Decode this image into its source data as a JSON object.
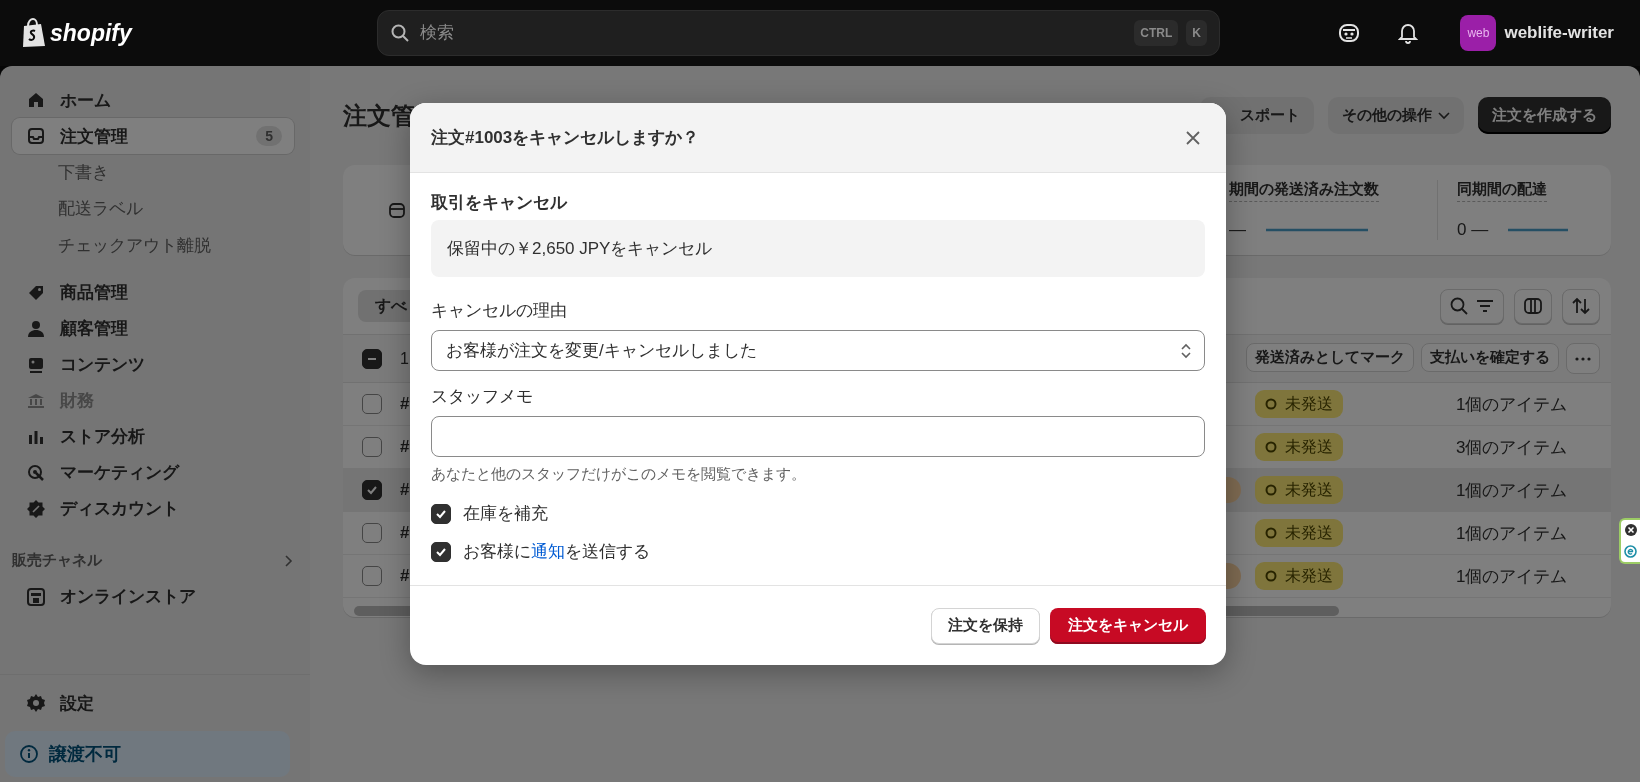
{
  "topbar": {
    "logo": "shopify",
    "search": {
      "placeholder": "検索",
      "keys": [
        "CTRL",
        "K"
      ]
    },
    "avatar": "web",
    "store_name": "weblife-writer"
  },
  "sidebar": {
    "items": [
      {
        "label": "ホーム",
        "selected": false,
        "disabled": false
      },
      {
        "label": "注文管理",
        "selected": true,
        "disabled": false,
        "badge": "5",
        "children": [
          {
            "label": "下書き"
          },
          {
            "label": "配送ラベル"
          },
          {
            "label": "チェックアウト離脱"
          }
        ]
      },
      {
        "label": "商品管理",
        "selected": false,
        "disabled": false
      },
      {
        "label": "顧客管理",
        "selected": false,
        "disabled": false
      },
      {
        "label": "コンテンツ",
        "selected": false,
        "disabled": false
      },
      {
        "label": "財務",
        "selected": false,
        "disabled": true
      },
      {
        "label": "ストア分析",
        "selected": false,
        "disabled": false
      },
      {
        "label": "マーケティング",
        "selected": false,
        "disabled": false
      },
      {
        "label": "ディスカウント",
        "selected": false,
        "disabled": false
      }
    ],
    "channels_title": "販売チャネル",
    "channels": [
      {
        "label": "オンラインストア",
        "selected": false,
        "disabled": false
      }
    ],
    "settings": "設定",
    "notice": "譲渡不可"
  },
  "main": {
    "title": "注文管",
    "header_buttons": [
      {
        "label": "スポート",
        "kind": "plain"
      },
      {
        "label": "その他の操作",
        "kind": "menu"
      },
      {
        "label": "注文を作成する",
        "kind": "primary"
      }
    ],
    "stats": [
      {
        "label": "期間の発送済み注文数",
        "value": "—"
      },
      {
        "label": "同期間の配達",
        "value": "0 —"
      }
    ],
    "table": {
      "tab": "すべ",
      "indeterminate": true,
      "selection_count": "1",
      "bulk_actions": [
        "発送済みとしてマーク",
        "支払いを確定する"
      ],
      "rows": [
        {
          "order": "#",
          "selected": false,
          "badge_2": false,
          "fulfillment": "未発送",
          "items": "1個のアイテム"
        },
        {
          "order": "#",
          "selected": false,
          "badge_2": false,
          "fulfillment": "未発送",
          "items": "3個のアイテム"
        },
        {
          "order": "#",
          "selected": true,
          "badge_2": true,
          "fulfillment": "未発送",
          "items": "1個のアイテム"
        },
        {
          "order": "#",
          "selected": false,
          "badge_2": false,
          "fulfillment": "未発送",
          "items": "1個のアイテム"
        },
        {
          "order": "#",
          "selected": false,
          "badge_2": true,
          "fulfillment": "未発送",
          "items": "1個のアイテム"
        }
      ]
    }
  },
  "modal": {
    "title": "注文#1003をキャンセルしますか？",
    "section_title": "取引をキャンセル",
    "transaction": "保留中の￥2,650 JPYをキャンセル",
    "reason_label": "キャンセルの理由",
    "reason_value": "お客様が注文を変更/キャンセルしました",
    "memo_label": "スタッフメモ",
    "memo_help": "あなたと他のスタッフだけがこのメモを閲覧できます。",
    "options": [
      {
        "label": "在庫を補充",
        "checked": true
      },
      {
        "label": "お客様に",
        "link": "通知",
        "label_after": "を送信する",
        "checked": true
      }
    ],
    "buttons": [
      {
        "label": "注文を保持",
        "kind": "secondary"
      },
      {
        "label": "注文をキャンセル",
        "kind": "critical"
      }
    ]
  }
}
